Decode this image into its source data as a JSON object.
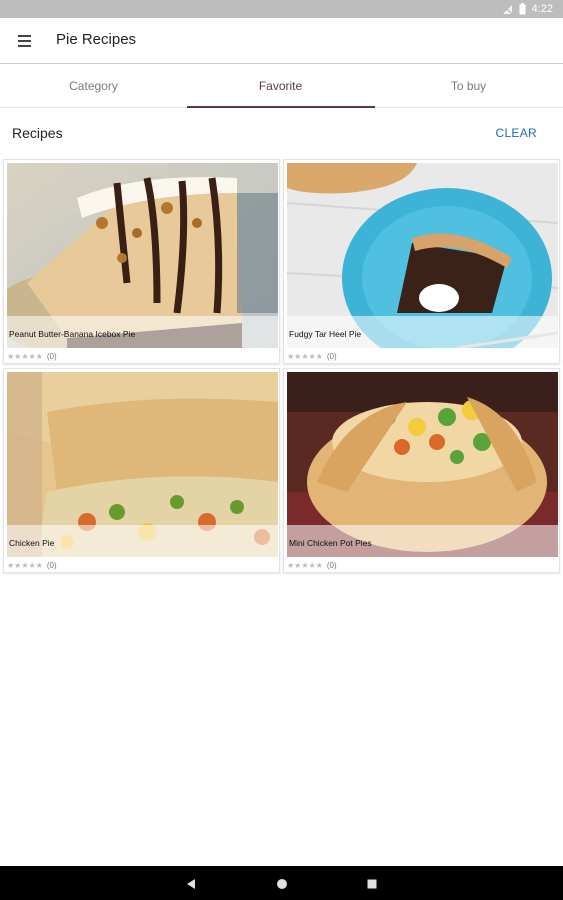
{
  "status": {
    "time": "4:22"
  },
  "appbar": {
    "title": "Pie Recipes",
    "menu_icon": "hamburger-menu-icon"
  },
  "tabs": [
    {
      "label": "Category",
      "active": false
    },
    {
      "label": "Favorite",
      "active": true
    },
    {
      "label": "To buy",
      "active": false
    }
  ],
  "section": {
    "title": "Recipes",
    "clear_label": "CLEAR"
  },
  "recipes": [
    {
      "name": "Peanut Butter-Banana Icebox Pie",
      "rating": "★★★★★",
      "count": "(0)"
    },
    {
      "name": "Fudgy Tar Heel Pie",
      "rating": "★★★★★",
      "count": "(0)"
    },
    {
      "name": "Chicken Pie",
      "rating": "★★★★★",
      "count": "(0)"
    },
    {
      "name": "Mini Chicken Pot Pies",
      "rating": "★★★★★",
      "count": "(0)"
    }
  ],
  "colors": {
    "accent": "#5b3a47",
    "link": "#1e6bb8"
  }
}
